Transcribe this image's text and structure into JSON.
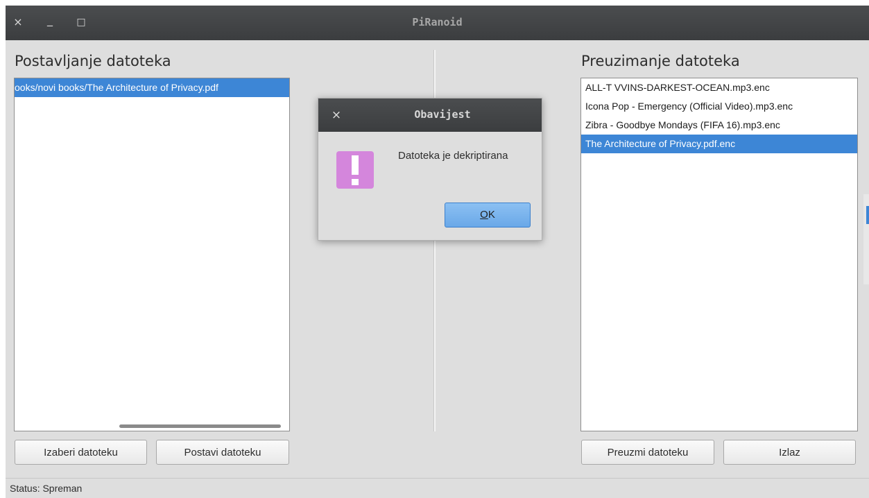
{
  "window": {
    "title": "PiRanoid",
    "close_glyph": "×",
    "minimize_glyph": "_",
    "maximize_glyph": "□"
  },
  "upload": {
    "heading": "Postavljanje datoteka",
    "items": [
      {
        "label": "ooks/novi books/The Architecture of Privacy.pdf",
        "selected": true
      }
    ],
    "choose_button": "Izaberi datoteku",
    "upload_button": "Postavi datoteku"
  },
  "download": {
    "heading": "Preuzimanje datoteka",
    "items": [
      {
        "label": "ALL-T VVINS-DARKEST-OCEAN.mp3.enc",
        "selected": false
      },
      {
        "label": "Icona Pop - Emergency (Official Video).mp3.enc",
        "selected": false
      },
      {
        "label": "Zibra - Goodbye Mondays (FIFA 16).mp3.enc",
        "selected": false
      },
      {
        "label": "The Architecture of Privacy.pdf.enc",
        "selected": true
      }
    ],
    "download_button": "Preuzmi datoteku",
    "exit_button": "Izlaz"
  },
  "status": {
    "text": "Status: Spreman"
  },
  "dialog": {
    "title": "Obavijest",
    "close_glyph": "×",
    "icon": "warning-exclamation-icon",
    "message": "Datoteka je dekriptirana",
    "ok_mnemonic": "O",
    "ok_rest": "K"
  },
  "colors": {
    "selection": "#3d86d6",
    "titlebar": "#3f4143",
    "warning_icon": "#d486dc",
    "ok_button": "#7ab4ee"
  }
}
